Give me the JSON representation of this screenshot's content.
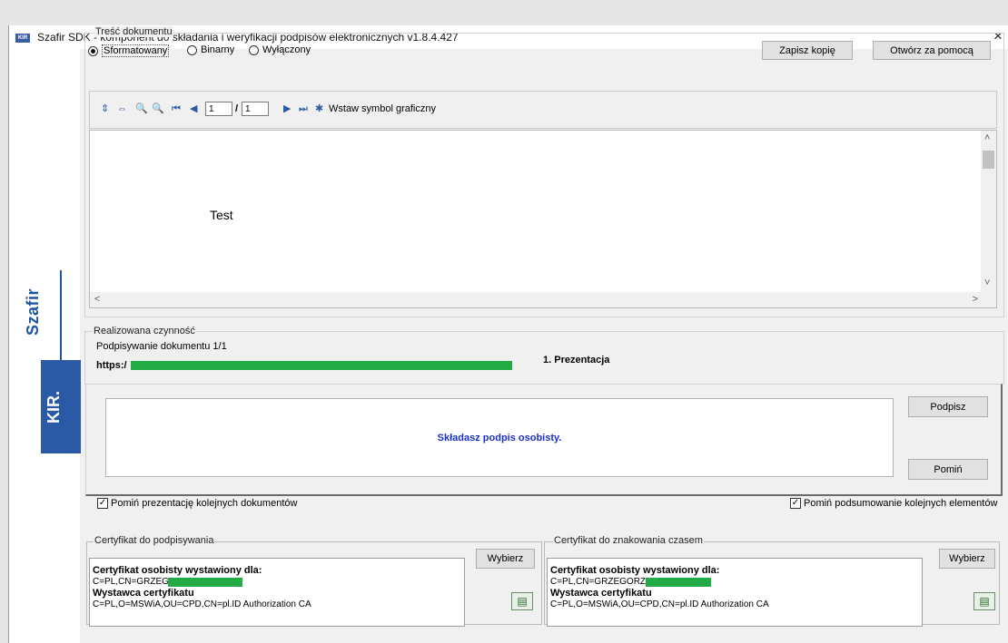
{
  "window": {
    "title": "Szafir SDK - komponent do składania i weryfikacji podpisów elektronicznych v1.8.4.427",
    "close": "×",
    "app_icon_text": "KIR"
  },
  "brand": {
    "name": "Szafir",
    "company": "KIR."
  },
  "document_content": {
    "group_label": "Treść dokumentu",
    "view_modes": [
      {
        "label": "Sformatowany",
        "selected": true
      },
      {
        "label": "Binarny",
        "selected": false
      },
      {
        "label": "Wyłączony",
        "selected": false
      }
    ],
    "save_copy": "Zapisz kopię",
    "open_with": "Otwórz za pomocą",
    "toolbar": {
      "page_current": "1",
      "page_separator": "/",
      "page_total": "1",
      "insert_symbol": "Wstaw symbol graficzny"
    },
    "preview_text": "Test"
  },
  "operation": {
    "group_label": "Realizowana czynność",
    "status": "Podpisywanie dokumentu 1/1",
    "url_prefix": "https:/",
    "step_label": "1. Prezentacja",
    "message": "Składasz podpis osobisty.",
    "sign_button": "Podpisz",
    "skip_button": "Pomiń"
  },
  "options": {
    "skip_presentation": "Pomiń prezentację kolejnych dokumentów",
    "skip_summary": "Pomiń podsumowanie kolejnych elementów"
  },
  "signing_cert": {
    "group_label": "Certyfikat do podpisywania",
    "select_button": "Wybierz",
    "issued_for_title": "Certyfikat osobisty wystawiony dla:",
    "subject": "C=PL,CN=GRZEGORZ",
    "issuer_title": "Wystawca certyfikatu",
    "issuer": "C=PL,O=MSWiA,OU=CPD,CN=pl.ID Authorization CA"
  },
  "timestamp_cert": {
    "group_label": "Certyfikat do znakowania czasem",
    "select_button": "Wybierz",
    "issued_for_title": "Certyfikat osobisty wystawiony dla:",
    "subject": "C=PL,CN=GRZEGORZ",
    "issuer_title": "Wystawca certyfikatu",
    "issuer": "C=PL,O=MSWiA,OU=CPD,CN=pl.ID Authorization CA"
  },
  "colors": {
    "accent": "#1f56a0",
    "message": "#1b2fcf",
    "redaction": "#22aa44"
  }
}
